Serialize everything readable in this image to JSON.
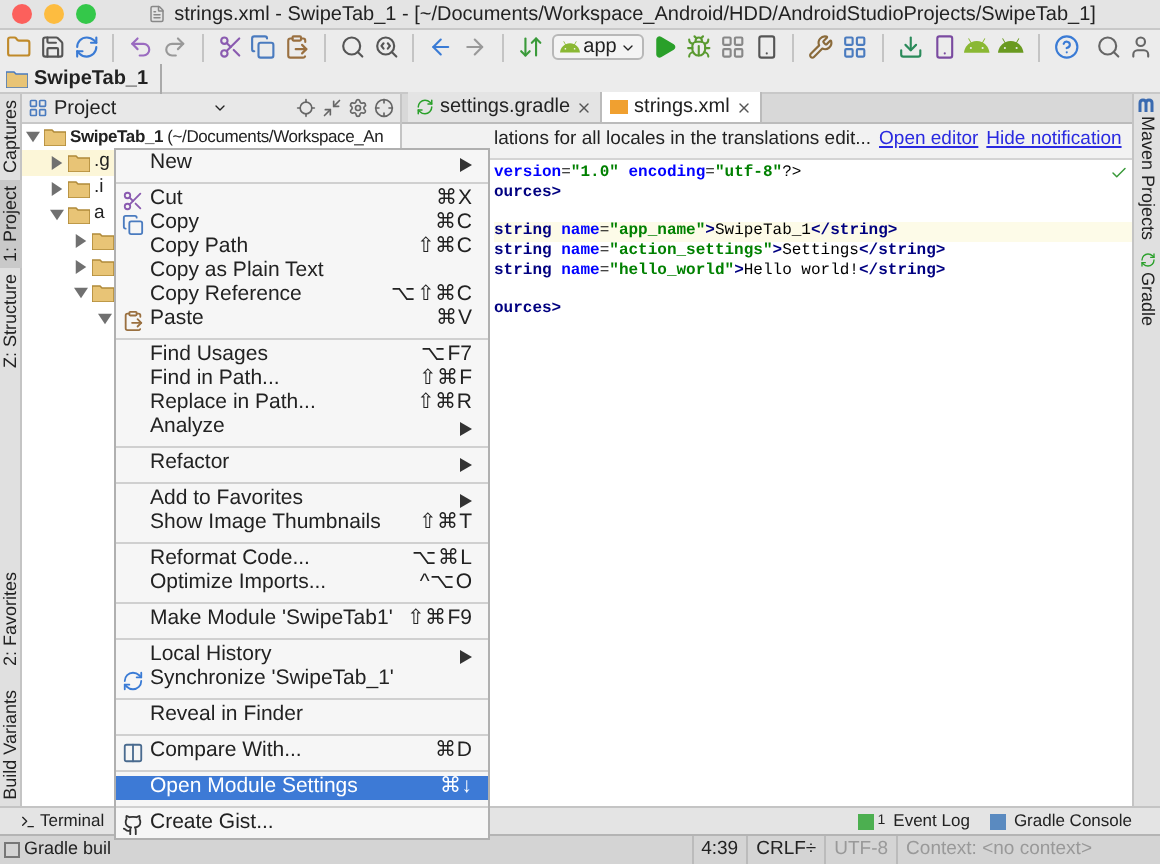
{
  "window": {
    "title": "strings.xml - SwipeTab_1 - [~/Documents/Workspace_Android/HDD/AndroidStudioProjects/SwipeTab_1]"
  },
  "toolbar": {
    "run_config": "app"
  },
  "breadcrumb": [
    "SwipeTab_1"
  ],
  "left_tool_tabs": [
    {
      "label": "Captures",
      "selected": false
    },
    {
      "label": "1: Project",
      "selected": true
    },
    {
      "label": "Z: Structure",
      "selected": false
    },
    {
      "label": "2: Favorites",
      "selected": false
    },
    {
      "label": "Build Variants",
      "selected": false
    }
  ],
  "right_tool_tabs": [
    {
      "label": "Maven Projects"
    },
    {
      "label": "Gradle"
    }
  ],
  "project_panel": {
    "view": "Project",
    "tree": [
      {
        "label": "**SwipeTab_1** (~/Documents/Workspace_An",
        "expanded": true,
        "selected": false,
        "children": [
          {
            "label": ".g",
            "expanded": false,
            "selected": true
          },
          {
            "label": ".i",
            "expanded": false,
            "selected": false
          },
          {
            "label": "a",
            "expanded": true,
            "selected": false,
            "children": [
              {
                "expanded": false,
                "selected": false
              },
              {
                "expanded": false,
                "selected": false
              },
              {
                "expanded": true,
                "selected": false,
                "children": [
                  {
                    "expanded": true,
                    "selected": false
                  }
                ]
              }
            ]
          }
        ]
      }
    ]
  },
  "editor_tabs": [
    {
      "label": "settings.gradle",
      "selected": false
    },
    {
      "label": "strings.xml",
      "selected": true
    }
  ],
  "notification": {
    "text": "lations for all locales in the translations edit...",
    "links": [
      "Open editor",
      "Hide notification"
    ]
  },
  "code_lines": [
    {
      "highlighted": false,
      "gap_before": false,
      "tokens": [
        {
          "kind": "attr",
          "text": "version"
        },
        {
          "kind": "plain",
          "text": "="
        },
        {
          "kind": "value",
          "text": "\"1.0\""
        },
        {
          "kind": "attr",
          "text": " encoding"
        },
        {
          "kind": "plain",
          "text": "="
        },
        {
          "kind": "value",
          "text": "\"utf-8\""
        },
        {
          "kind": "plain",
          "text": "?>"
        }
      ]
    },
    {
      "highlighted": false,
      "gap_before": false,
      "tokens": [
        {
          "kind": "tag",
          "text": "ources>"
        }
      ]
    },
    {
      "highlighted": true,
      "gap_before": true,
      "tokens": [
        {
          "kind": "tag",
          "text": "string"
        },
        {
          "kind": "attr",
          "text": " name"
        },
        {
          "kind": "plain",
          "text": "="
        },
        {
          "kind": "value",
          "text": "\"app_name\""
        },
        {
          "kind": "tag",
          "text": ">"
        },
        {
          "kind": "plain",
          "text": "SwipeTab_1"
        },
        {
          "kind": "tag",
          "text": "</string>"
        }
      ]
    },
    {
      "highlighted": false,
      "gap_before": false,
      "tokens": [
        {
          "kind": "tag",
          "text": "string"
        },
        {
          "kind": "attr",
          "text": " name"
        },
        {
          "kind": "plain",
          "text": "="
        },
        {
          "kind": "value",
          "text": "\"action_settings\""
        },
        {
          "kind": "tag",
          "text": ">"
        },
        {
          "kind": "plain",
          "text": "Settings"
        },
        {
          "kind": "tag",
          "text": "</string>"
        }
      ]
    },
    {
      "highlighted": false,
      "gap_before": false,
      "tokens": [
        {
          "kind": "tag",
          "text": "string"
        },
        {
          "kind": "attr",
          "text": " name"
        },
        {
          "kind": "plain",
          "text": "="
        },
        {
          "kind": "value",
          "text": "\"hello_world\""
        },
        {
          "kind": "tag",
          "text": ">"
        },
        {
          "kind": "plain",
          "text": "Hello world!"
        },
        {
          "kind": "tag",
          "text": "</string>"
        }
      ]
    },
    {
      "highlighted": false,
      "gap_before": true,
      "tokens": [
        {
          "kind": "tag",
          "text": "ources>"
        }
      ]
    }
  ],
  "context_menu": {
    "groups": [
      [
        {
          "label": "New",
          "submenu": true,
          "selected": false
        }
      ],
      [
        {
          "label": "Cut",
          "shortcut": "⌘X",
          "submenu": false,
          "selected": false
        },
        {
          "label": "Copy",
          "shortcut": "⌘C",
          "submenu": false,
          "selected": false
        },
        {
          "label": "Copy Path",
          "shortcut": "⇧⌘C",
          "submenu": false,
          "selected": false
        },
        {
          "label": "Copy as Plain Text",
          "submenu": false,
          "selected": false
        },
        {
          "label": "Copy Reference",
          "shortcut": "⌥⇧⌘C",
          "submenu": false,
          "selected": false
        },
        {
          "label": "Paste",
          "shortcut": "⌘V",
          "submenu": false,
          "selected": false
        }
      ],
      [
        {
          "label": "Find Usages",
          "shortcut": "⌥F7",
          "submenu": false,
          "selected": false
        },
        {
          "label": "Find in Path...",
          "shortcut": "⇧⌘F",
          "submenu": false,
          "selected": false
        },
        {
          "label": "Replace in Path...",
          "shortcut": "⇧⌘R",
          "submenu": false,
          "selected": false
        },
        {
          "label": "Analyze",
          "submenu": true,
          "selected": false
        }
      ],
      [
        {
          "label": "Refactor",
          "submenu": true,
          "selected": false
        }
      ],
      [
        {
          "label": "Add to Favorites",
          "submenu": true,
          "selected": false
        },
        {
          "label": "Show Image Thumbnails",
          "shortcut": "⇧⌘T",
          "submenu": false,
          "selected": false
        }
      ],
      [
        {
          "label": "Reformat Code...",
          "shortcut": "⌥⌘L",
          "submenu": false,
          "selected": false
        },
        {
          "label": "Optimize Imports...",
          "shortcut": "^⌥O",
          "submenu": false,
          "selected": false
        }
      ],
      [
        {
          "label": "Make Module 'SwipeTab1'",
          "shortcut": "⇧⌘F9",
          "submenu": false,
          "selected": false
        }
      ],
      [
        {
          "label": "Local History",
          "submenu": true,
          "selected": false
        },
        {
          "label": "Synchronize 'SwipeTab_1'",
          "submenu": false,
          "selected": false
        }
      ],
      [
        {
          "label": "Reveal in Finder",
          "submenu": false,
          "selected": false
        }
      ],
      [
        {
          "label": "Compare With...",
          "shortcut": "⌘D",
          "submenu": false,
          "selected": false
        }
      ],
      [
        {
          "label": "Open Module Settings",
          "shortcut": "⌘↓",
          "submenu": false,
          "selected": true
        }
      ],
      [
        {
          "label": "Create Gist...",
          "submenu": false,
          "selected": false
        }
      ]
    ]
  },
  "tool_window_bar": {
    "left": [
      {
        "label": "Terminal"
      }
    ],
    "right": [
      {
        "label": "Event Log",
        "badge": "1"
      },
      {
        "label": "Gradle Console"
      }
    ]
  },
  "status_bar": {
    "message": "Gradle buil",
    "segments": [
      {
        "text": "4:39",
        "disabled": false
      },
      {
        "text": "CRLF÷",
        "disabled": false
      },
      {
        "text": "UTF-8",
        "disabled": true
      },
      {
        "text": "Context: <no context>",
        "disabled": true
      }
    ]
  }
}
